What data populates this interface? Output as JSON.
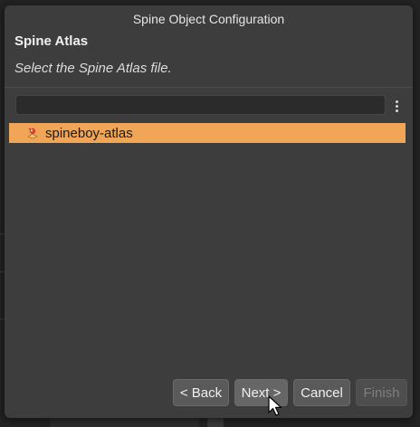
{
  "dialog": {
    "title": "Spine Object Configuration",
    "heading": "Spine Atlas",
    "description": "Select the Spine Atlas file.",
    "search": {
      "value": "",
      "placeholder": ""
    },
    "files": [
      {
        "label": "spineboy-atlas",
        "icon": "spine-atlas-icon",
        "selected": true
      }
    ],
    "buttons": {
      "back": "< Back",
      "next": "Next >",
      "cancel": "Cancel",
      "finish": "Finish"
    }
  },
  "colors": {
    "dialog_bg": "#3d3d3d",
    "selection": "#f0a557",
    "button_bg": "#5a5a5a",
    "disabled_text": "#7e7e7e"
  }
}
